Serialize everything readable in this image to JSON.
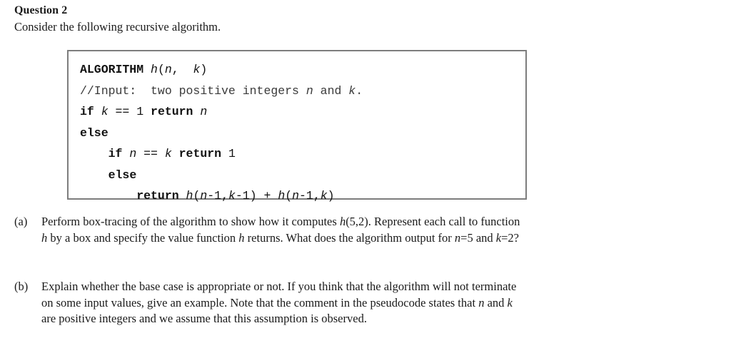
{
  "question": {
    "title": "Question 2",
    "intro": "Consider the following recursive algorithm."
  },
  "algorithm_box": {
    "border_color": "#7d7d7d",
    "lines": [
      {
        "indent": 0,
        "segments": [
          {
            "text": "ALGORITHM",
            "style": "bold"
          },
          {
            "text": " ",
            "style": "plain"
          },
          {
            "text": "h",
            "style": "italic"
          },
          {
            "text": "(",
            "style": "plain"
          },
          {
            "text": "n",
            "style": "italic"
          },
          {
            "text": ",  ",
            "style": "plain"
          },
          {
            "text": "k",
            "style": "italic"
          },
          {
            "text": ")",
            "style": "plain"
          }
        ],
        "plain_text": "ALGORITHM h(n,  k)"
      },
      {
        "indent": 0,
        "segments": [
          {
            "text": "//Input:  two positive integers ",
            "style": "comment"
          },
          {
            "text": "n",
            "style": "comment-italic"
          },
          {
            "text": " and ",
            "style": "comment"
          },
          {
            "text": "k",
            "style": "comment-italic"
          },
          {
            "text": ".",
            "style": "comment"
          }
        ],
        "plain_text": "//Input:  two positive integers n and k."
      },
      {
        "indent": 0,
        "segments": [
          {
            "text": "if",
            "style": "bold"
          },
          {
            "text": " ",
            "style": "plain"
          },
          {
            "text": "k",
            "style": "italic"
          },
          {
            "text": " == 1 ",
            "style": "plain"
          },
          {
            "text": "return",
            "style": "bold"
          },
          {
            "text": " ",
            "style": "plain"
          },
          {
            "text": "n",
            "style": "italic"
          }
        ],
        "plain_text": "if k == 1 return n"
      },
      {
        "indent": 0,
        "segments": [
          {
            "text": "else",
            "style": "bold"
          }
        ],
        "plain_text": "else"
      },
      {
        "indent": 4,
        "segments": [
          {
            "text": "if",
            "style": "bold"
          },
          {
            "text": " ",
            "style": "plain"
          },
          {
            "text": "n",
            "style": "italic"
          },
          {
            "text": " == ",
            "style": "plain"
          },
          {
            "text": "k",
            "style": "italic"
          },
          {
            "text": " ",
            "style": "plain"
          },
          {
            "text": "return",
            "style": "bold"
          },
          {
            "text": " 1",
            "style": "plain"
          }
        ],
        "plain_text": "    if n == k return 1"
      },
      {
        "indent": 4,
        "segments": [
          {
            "text": "else",
            "style": "bold"
          }
        ],
        "plain_text": "    else"
      },
      {
        "indent": 8,
        "segments": [
          {
            "text": "return",
            "style": "bold"
          },
          {
            "text": " ",
            "style": "plain"
          },
          {
            "text": "h",
            "style": "italic"
          },
          {
            "text": "(",
            "style": "plain"
          },
          {
            "text": "n",
            "style": "italic"
          },
          {
            "text": "-1,",
            "style": "plain"
          },
          {
            "text": "k",
            "style": "italic"
          },
          {
            "text": "-1) + ",
            "style": "plain"
          },
          {
            "text": "h",
            "style": "italic"
          },
          {
            "text": "(",
            "style": "plain"
          },
          {
            "text": "n",
            "style": "italic"
          },
          {
            "text": "-1,",
            "style": "plain"
          },
          {
            "text": "k",
            "style": "italic"
          },
          {
            "text": ")",
            "style": "plain"
          }
        ],
        "plain_text": "        return h(n-1,k-1) + h(n-1,k)"
      }
    ]
  },
  "parts": [
    {
      "label": "(a)",
      "lines": [
        [
          {
            "text": "Perform box-tracing of the algorithm to show how it computes ",
            "style": "plain"
          },
          {
            "text": "h",
            "style": "italic"
          },
          {
            "text": "(5,2). Represent each call to function",
            "style": "plain"
          }
        ],
        [
          {
            "text": "h",
            "style": "italic"
          },
          {
            "text": " by a box and specify the value function ",
            "style": "plain"
          },
          {
            "text": "h",
            "style": "italic"
          },
          {
            "text": " returns. What does the algorithm output for ",
            "style": "plain"
          },
          {
            "text": "n",
            "style": "italic"
          },
          {
            "text": "=5 and ",
            "style": "plain"
          },
          {
            "text": "k",
            "style": "italic"
          },
          {
            "text": "=2?",
            "style": "plain"
          }
        ]
      ],
      "plain_text": "Perform box-tracing of the algorithm to show how it computes h(5,2). Represent each call to function h by a box and specify the value function h returns. What does the algorithm output for n=5 and k=2?"
    },
    {
      "label": "(b)",
      "lines": [
        [
          {
            "text": "Explain whether the base case is appropriate or not. If you think that the algorithm will not terminate",
            "style": "plain"
          }
        ],
        [
          {
            "text": "on some input values, give an example. Note that the comment in the pseudocode states that ",
            "style": "plain"
          },
          {
            "text": "n",
            "style": "italic"
          },
          {
            "text": " and ",
            "style": "plain"
          },
          {
            "text": "k",
            "style": "italic"
          }
        ],
        [
          {
            "text": "are positive integers and we assume that this assumption is observed.",
            "style": "plain"
          }
        ]
      ],
      "plain_text": "Explain whether the base case is appropriate or not. If you think that the algorithm will not terminate on some input values, give an example. Note that the comment in the pseudocode states that n and k are positive integers and we assume that this assumption is observed."
    }
  ]
}
